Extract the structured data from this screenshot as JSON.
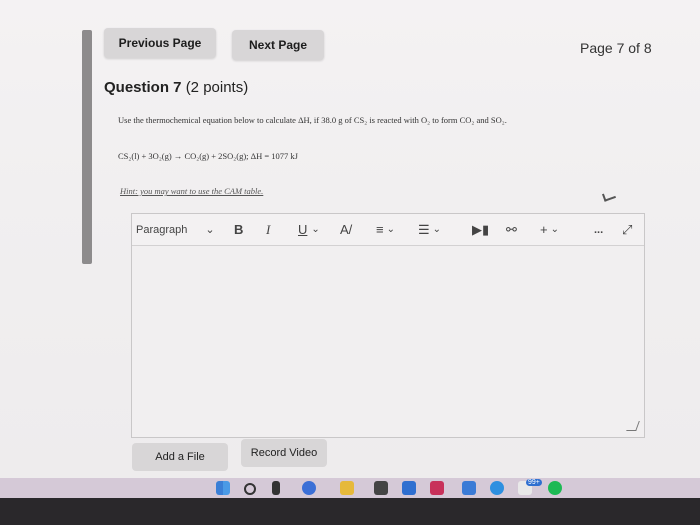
{
  "nav": {
    "previous_label": "Previous Page",
    "next_label": "Next Page",
    "page_indicator": "Page 7 of 8"
  },
  "question": {
    "number_label": "Question 7",
    "points_label": "(2 points)",
    "prompt": "Use the thermochemical equation below to calculate ΔH, if 38.0 g of CS₂ is reacted with O₂ to form CO₂ and SO₂.",
    "equation": "CS₂(l) + 3O₂(g) → CO₂(g) + 2SO₂(g); ΔH = 1077 kJ",
    "hint": "Hint: you may want to use the CAM table."
  },
  "editor": {
    "format_select": "Paragraph",
    "bold": "B",
    "italic": "I",
    "underline": "U",
    "more": "..."
  },
  "actions": {
    "add_file_label": "Add a File",
    "record_video_label": "Record Video"
  },
  "taskbar": {
    "badge": "99+"
  },
  "colors": {
    "screen_bg": "#f1eff0",
    "button_bg": "#d8d6d7",
    "taskbar_bg": "#2a282b",
    "taskbar_strip": "#d5c9d7"
  }
}
